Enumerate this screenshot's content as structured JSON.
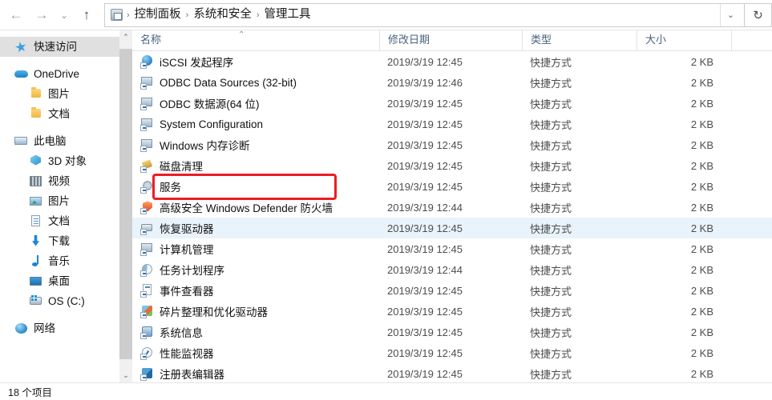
{
  "window": {
    "nav": {
      "back_icon": "arrow-left-icon",
      "forward_icon": "arrow-right-icon",
      "history_icon": "chevron-down-icon",
      "up_icon": "arrow-up-icon",
      "refresh_icon": "refresh-icon",
      "address_chevron_icon": "chevron-down-icon"
    },
    "breadcrumbs": [
      "控制面板",
      "系统和安全",
      "管理工具"
    ],
    "breadcrumb_separator": "›"
  },
  "sidebar": {
    "items": [
      {
        "label": "快速访问",
        "icon": "star-icon",
        "level": 1,
        "selected": true
      },
      {
        "label": "OneDrive",
        "icon": "cloud-icon",
        "level": 1,
        "selected": false
      },
      {
        "label": "图片",
        "icon": "folder-icon",
        "level": 2,
        "selected": false
      },
      {
        "label": "文档",
        "icon": "folder-icon",
        "level": 2,
        "selected": false
      },
      {
        "label": "此电脑",
        "icon": "computer-icon",
        "level": 1,
        "selected": false
      },
      {
        "label": "3D 对象",
        "icon": "cube-icon",
        "level": 2,
        "selected": false
      },
      {
        "label": "视频",
        "icon": "video-icon",
        "level": 2,
        "selected": false
      },
      {
        "label": "图片",
        "icon": "picture-icon",
        "level": 2,
        "selected": false
      },
      {
        "label": "文档",
        "icon": "document-icon",
        "level": 2,
        "selected": false
      },
      {
        "label": "下载",
        "icon": "download-icon",
        "level": 2,
        "selected": false
      },
      {
        "label": "音乐",
        "icon": "music-icon",
        "level": 2,
        "selected": false
      },
      {
        "label": "桌面",
        "icon": "desktop-icon",
        "level": 2,
        "selected": false
      },
      {
        "label": "OS (C:)",
        "icon": "drive-icon",
        "level": 2,
        "selected": false
      },
      {
        "label": "网络",
        "icon": "network-icon",
        "level": 1,
        "selected": false
      }
    ],
    "scrollbar": {
      "up_arrow_icon": "chevron-up-icon",
      "down_arrow_icon": "chevron-down-icon"
    }
  },
  "filelist": {
    "columns": [
      {
        "label": "名称",
        "key": "name"
      },
      {
        "label": "修改日期",
        "key": "date"
      },
      {
        "label": "类型",
        "key": "type"
      },
      {
        "label": "大小",
        "key": "size"
      }
    ],
    "sort_indicator_icon": "sort-ascending-icon",
    "rows": [
      {
        "name": "iSCSI 发起程序",
        "date": "2019/3/19 12:45",
        "type": "快捷方式",
        "size": "2 KB",
        "icon": "globe-shortcut-icon",
        "highlighted": false
      },
      {
        "name": "ODBC Data Sources (32-bit)",
        "date": "2019/3/19 12:46",
        "type": "快捷方式",
        "size": "2 KB",
        "icon": "monitor-shortcut-icon",
        "highlighted": false
      },
      {
        "name": "ODBC 数据源(64 位)",
        "date": "2019/3/19 12:45",
        "type": "快捷方式",
        "size": "2 KB",
        "icon": "monitor-shortcut-icon",
        "highlighted": false
      },
      {
        "name": "System Configuration",
        "date": "2019/3/19 12:45",
        "type": "快捷方式",
        "size": "2 KB",
        "icon": "monitor-shortcut-icon",
        "highlighted": false
      },
      {
        "name": "Windows 内存诊断",
        "date": "2019/3/19 12:45",
        "type": "快捷方式",
        "size": "2 KB",
        "icon": "memory-shortcut-icon",
        "highlighted": false
      },
      {
        "name": "磁盘清理",
        "date": "2019/3/19 12:45",
        "type": "快捷方式",
        "size": "2 KB",
        "icon": "brush-shortcut-icon",
        "highlighted": false
      },
      {
        "name": "服务",
        "date": "2019/3/19 12:45",
        "type": "快捷方式",
        "size": "2 KB",
        "icon": "gear-shortcut-icon",
        "highlighted": false
      },
      {
        "name": "高级安全 Windows Defender 防火墙",
        "date": "2019/3/19 12:44",
        "type": "快捷方式",
        "size": "2 KB",
        "icon": "shield-shortcut-icon",
        "highlighted": false
      },
      {
        "name": "恢复驱动器",
        "date": "2019/3/19 12:45",
        "type": "快捷方式",
        "size": "2 KB",
        "icon": "drive-shortcut-icon",
        "highlighted": true
      },
      {
        "name": "计算机管理",
        "date": "2019/3/19 12:45",
        "type": "快捷方式",
        "size": "2 KB",
        "icon": "computer-shortcut-icon",
        "highlighted": false
      },
      {
        "name": "任务计划程序",
        "date": "2019/3/19 12:44",
        "type": "快捷方式",
        "size": "2 KB",
        "icon": "pie-shortcut-icon",
        "highlighted": false
      },
      {
        "name": "事件查看器",
        "date": "2019/3/19 12:45",
        "type": "快捷方式",
        "size": "2 KB",
        "icon": "document-shortcut-icon",
        "highlighted": false
      },
      {
        "name": "碎片整理和优化驱动器",
        "date": "2019/3/19 12:45",
        "type": "快捷方式",
        "size": "2 KB",
        "icon": "defrag-shortcut-icon",
        "highlighted": false
      },
      {
        "name": "系统信息",
        "date": "2019/3/19 12:45",
        "type": "快捷方式",
        "size": "2 KB",
        "icon": "info-shortcut-icon",
        "highlighted": false
      },
      {
        "name": "性能监视器",
        "date": "2019/3/19 12:45",
        "type": "快捷方式",
        "size": "2 KB",
        "icon": "performance-shortcut-icon",
        "highlighted": false
      },
      {
        "name": "注册表编辑器",
        "date": "2019/3/19 12:45",
        "type": "快捷方式",
        "size": "2 KB",
        "icon": "registry-shortcut-icon",
        "highlighted": false
      }
    ]
  },
  "annotation": {
    "color": "#ec1c24",
    "target_row_name": "服务"
  },
  "statusbar": {
    "item_count_label": "18 个项目"
  }
}
